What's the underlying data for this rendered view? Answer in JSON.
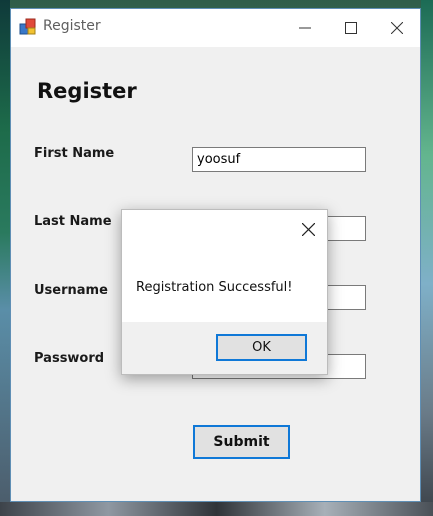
{
  "window": {
    "title": "Register",
    "minimize_icon": "minimize-icon",
    "maximize_icon": "maximize-icon",
    "close_icon": "close-icon"
  },
  "form": {
    "heading": "Register",
    "fields": [
      {
        "label": "First Name",
        "value": "yoosuf"
      },
      {
        "label": "Last Name",
        "value": ""
      },
      {
        "label": "Username",
        "value": ""
      },
      {
        "label": "Password",
        "value": ""
      }
    ],
    "submit_label": "Submit"
  },
  "dialog": {
    "message": "Registration Successful!",
    "ok_label": "OK",
    "close_icon": "close-icon"
  },
  "colors": {
    "accent": "#0f78d7",
    "window_bg": "#f0f0f0",
    "button_bg": "#e1e1e1"
  }
}
